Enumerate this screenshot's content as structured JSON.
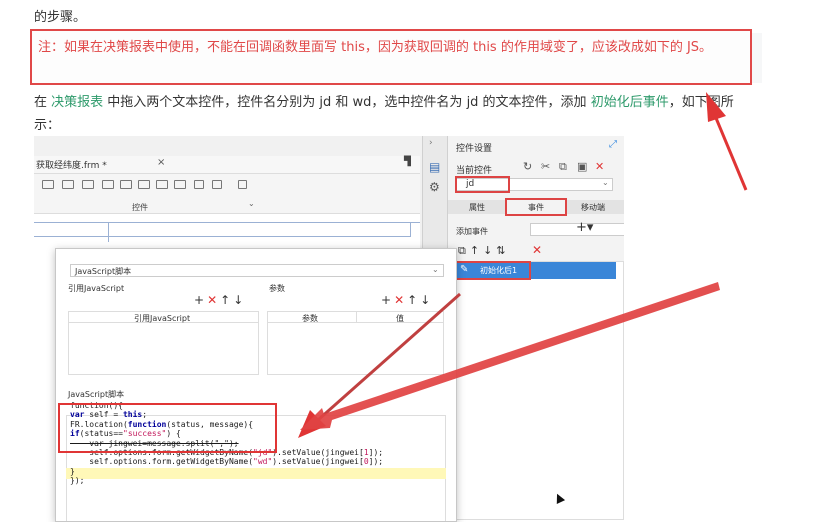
{
  "doc": {
    "top_line": "的步骤。",
    "note": "注：如果在决策报表中使用，不能在回调函数里面写 this，因为获取回调的 this 的作用域变了，应该改成如下的 JS。",
    "para_part1": "在 ",
    "para_link1": "决策报表",
    "para_part2": " 中拖入两个文本控件，控件名分别为 jd 和 wd，选中控件名为 jd 的文本控件，添加 ",
    "para_link2": "初始化后事件",
    "para_part3": "，如下图所示："
  },
  "designer": {
    "file_tab": "获取经纬度.frm *",
    "file_close": "×",
    "pin": "▜",
    "widget_panel_label": "控件",
    "widget_panel_chevron": "⌄"
  },
  "properties": {
    "title": "控件设置",
    "current_widget_label": "当前控件",
    "current_widget_value": "jd",
    "tabs": [
      "属性",
      "事件",
      "移动端"
    ],
    "add_event_label": "添加事件",
    "add_event_symbol": "+▾",
    "event_item": "初始化后1"
  },
  "dialog": {
    "type_select": "JavaScript脚本",
    "ref_label": "引用JavaScript",
    "param_label": "参数",
    "ref_column": "引用JavaScript",
    "param_columns": [
      "参数",
      "值"
    ],
    "script_label": "JavaScript脚本"
  },
  "code_lines": [
    "function(){",
    "var self = this;",
    "FR.location(function(status, message){",
    "if(status==\"success\") {",
    "    var jingwei=message.split(\",\");",
    "    self.options.form.getWidgetByName(\"jd\").setValue(jingwei[1]);",
    "    self.options.form.getWidgetByName(\"wd\").setValue(jingwei[0]);",
    "",
    "}",
    "});"
  ],
  "colors": {
    "accent_red": "#e04848",
    "link_green": "#2e9a6b",
    "selected_blue": "#3a86d8"
  }
}
